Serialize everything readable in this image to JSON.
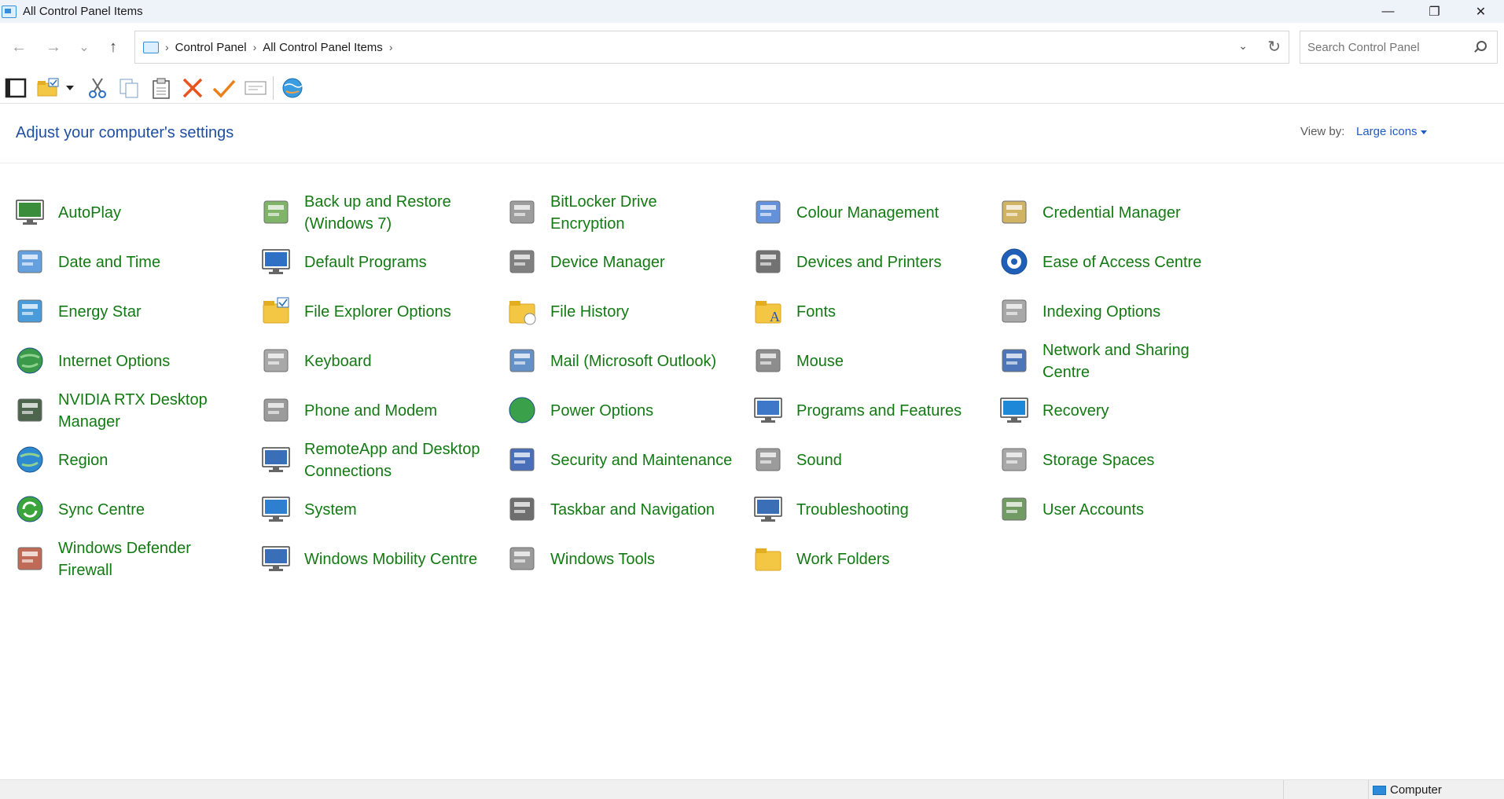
{
  "window": {
    "title": "All Control Panel Items",
    "minimize_label": "—",
    "restore_label": "❐",
    "close_label": "✕"
  },
  "nav": {
    "back_glyph": "←",
    "forward_glyph": "→",
    "recent_glyph": "⌄",
    "up_glyph": "↑"
  },
  "breadcrumb": {
    "items": [
      "Control Panel",
      "All Control Panel Items"
    ],
    "sep": "›"
  },
  "search": {
    "placeholder": "Search Control Panel",
    "value": ""
  },
  "toolbar": {
    "icons": [
      "layout-pane-icon",
      "new-folder-icon",
      "dropdown-arrow-icon",
      "cut-icon",
      "copy-icon",
      "paste-icon",
      "delete-icon",
      "checkmark-icon",
      "rename-icon",
      "globe-icon"
    ]
  },
  "header": {
    "title": "Adjust your computer's settings",
    "view_by_label": "View by:",
    "view_by_value": "Large icons"
  },
  "items": [
    {
      "label": "AutoPlay",
      "icon": "autoplay-icon",
      "color": "#3a8d3a"
    },
    {
      "label": "Back up and Restore (Windows 7)",
      "icon": "backup-icon",
      "color": "#6aa84f"
    },
    {
      "label": "BitLocker Drive Encryption",
      "icon": "bitlocker-icon",
      "color": "#8c8c8c"
    },
    {
      "label": "Colour Management",
      "icon": "colour-management-icon",
      "color": "#4a7fd4"
    },
    {
      "label": "Credential Manager",
      "icon": "credential-manager-icon",
      "color": "#c9a64a"
    },
    {
      "label": "Date and Time",
      "icon": "date-time-icon",
      "color": "#4a90d9"
    },
    {
      "label": "Default Programs",
      "icon": "default-programs-icon",
      "color": "#2f6fc4"
    },
    {
      "label": "Device Manager",
      "icon": "device-manager-icon",
      "color": "#6b6b6b"
    },
    {
      "label": "Devices and Printers",
      "icon": "printer-icon",
      "color": "#5a5a5a"
    },
    {
      "label": "Ease of Access Centre",
      "icon": "ease-of-access-icon",
      "color": "#1f5fb8"
    },
    {
      "label": "Energy Star",
      "icon": "energy-star-icon",
      "color": "#2a8ad4"
    },
    {
      "label": "File Explorer Options",
      "icon": "file-explorer-options-icon",
      "color": "#f3c744"
    },
    {
      "label": "File History",
      "icon": "file-history-icon",
      "color": "#e8b93a"
    },
    {
      "label": "Fonts",
      "icon": "fonts-icon",
      "color": "#e8b93a"
    },
    {
      "label": "Indexing Options",
      "icon": "indexing-options-icon",
      "color": "#9a9a9a"
    },
    {
      "label": "Internet Options",
      "icon": "internet-options-icon",
      "color": "#3a9a4a"
    },
    {
      "label": "Keyboard",
      "icon": "keyboard-icon",
      "color": "#9a9a9a"
    },
    {
      "label": "Mail (Microsoft Outlook)",
      "icon": "mail-icon",
      "color": "#4a7fbf"
    },
    {
      "label": "Mouse",
      "icon": "mouse-icon",
      "color": "#7a7a7a"
    },
    {
      "label": "Network and Sharing Centre",
      "icon": "network-icon",
      "color": "#2e5fae"
    },
    {
      "label": "NVIDIA RTX Desktop Manager",
      "icon": "nvidia-icon",
      "color": "#2e4a2e"
    },
    {
      "label": "Phone and Modem",
      "icon": "phone-modem-icon",
      "color": "#8a8a8a"
    },
    {
      "label": "Power Options",
      "icon": "power-options-icon",
      "color": "#3aa04a"
    },
    {
      "label": "Programs and Features",
      "icon": "programs-features-icon",
      "color": "#3d78c8"
    },
    {
      "label": "Recovery",
      "icon": "recovery-icon",
      "color": "#1e88d8"
    },
    {
      "label": "Region",
      "icon": "region-icon",
      "color": "#2e8ad0"
    },
    {
      "label": "RemoteApp and Desktop Connections",
      "icon": "remoteapp-icon",
      "color": "#3a6fb8"
    },
    {
      "label": "Security and Maintenance",
      "icon": "security-flag-icon",
      "color": "#2a56b0"
    },
    {
      "label": "Sound",
      "icon": "sound-icon",
      "color": "#8a8a8a"
    },
    {
      "label": "Storage Spaces",
      "icon": "storage-spaces-icon",
      "color": "#9a9a9a"
    },
    {
      "label": "Sync Centre",
      "icon": "sync-centre-icon",
      "color": "#3ba43b"
    },
    {
      "label": "System",
      "icon": "system-icon",
      "color": "#2f7fd0"
    },
    {
      "label": "Taskbar and Navigation",
      "icon": "taskbar-icon",
      "color": "#555555"
    },
    {
      "label": "Troubleshooting",
      "icon": "troubleshooting-icon",
      "color": "#3a6fb8"
    },
    {
      "label": "User Accounts",
      "icon": "user-accounts-icon",
      "color": "#5a8a4a"
    },
    {
      "label": "Windows Defender Firewall",
      "icon": "firewall-icon",
      "color": "#b5523a"
    },
    {
      "label": "Windows Mobility Centre",
      "icon": "mobility-centre-icon",
      "color": "#3a6fb8"
    },
    {
      "label": "Windows Tools",
      "icon": "windows-tools-icon",
      "color": "#8a8a8a"
    },
    {
      "label": "Work Folders",
      "icon": "work-folders-icon",
      "color": "#e8b93a"
    }
  ],
  "status": {
    "computer_label": "Computer"
  },
  "colors": {
    "link_green": "#137a13",
    "heading_blue": "#1f4fa3",
    "accent_blue": "#1f5bc4"
  }
}
